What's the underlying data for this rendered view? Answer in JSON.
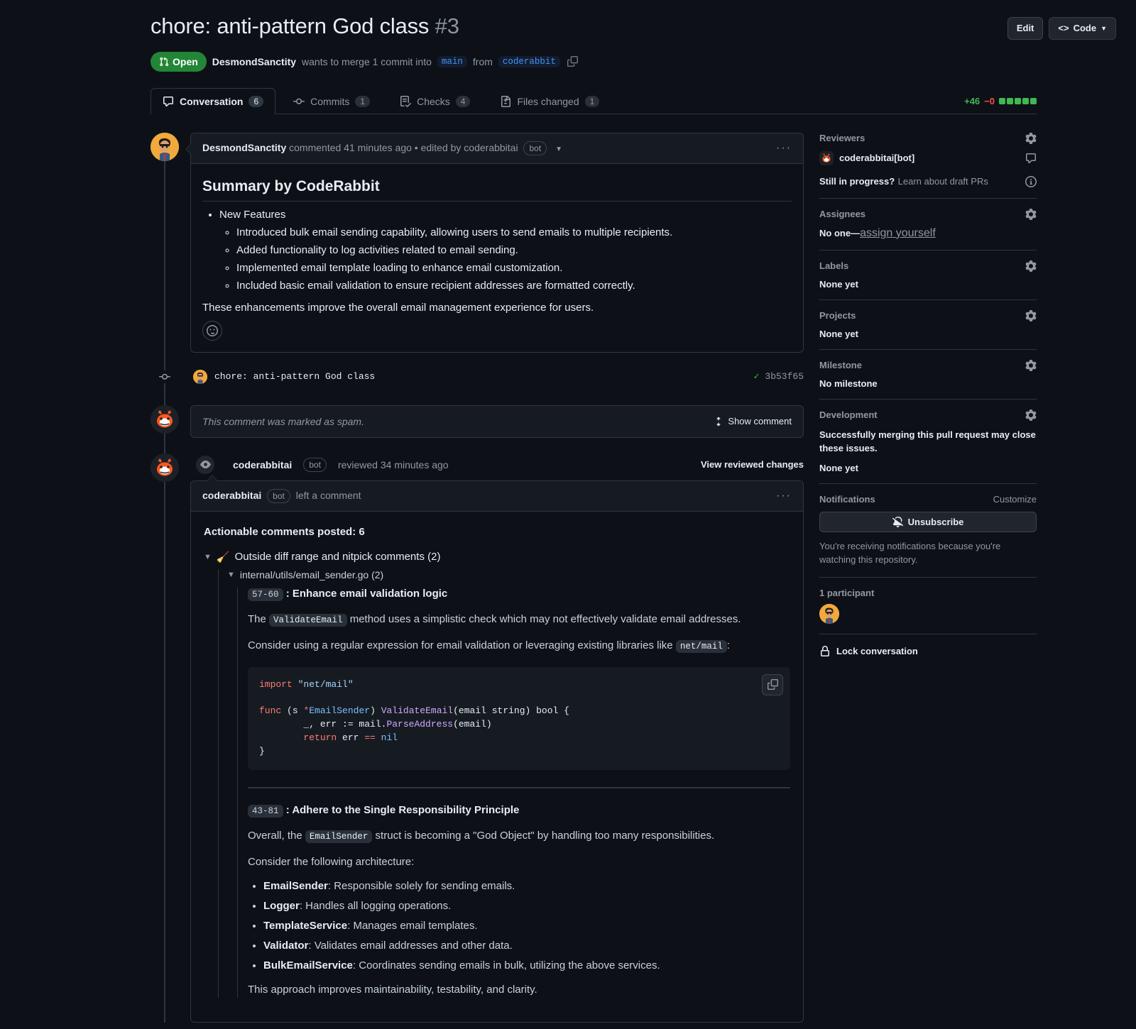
{
  "header": {
    "title": "chore: anti-pattern God class",
    "number": "#3",
    "state": "Open",
    "author": "DesmondSanctity",
    "merge_text_1": "wants to merge 1 commit into",
    "base_branch": "main",
    "from_text": "from",
    "head_branch": "coderabbit",
    "edit_label": "Edit",
    "code_label": "Code"
  },
  "tabs": [
    {
      "label": "Conversation",
      "count": "6",
      "icon": "comment-icon",
      "active": true
    },
    {
      "label": "Commits",
      "count": "1",
      "icon": "commit-icon",
      "active": false
    },
    {
      "label": "Checks",
      "count": "4",
      "icon": "checklist-icon",
      "active": false
    },
    {
      "label": "Files changed",
      "count": "1",
      "icon": "file-diff-icon",
      "active": false
    }
  ],
  "diffstat": {
    "additions": "+46",
    "deletions": "−0",
    "blocks": 5,
    "add_color": "#3fb950",
    "del_color": "#f85149"
  },
  "first_comment": {
    "author": "DesmondSanctity",
    "action": "commented 41 minutes ago",
    "separator": "•",
    "edited_by": "edited by coderabbitai",
    "bot_tag": "bot",
    "heading": "Summary by CodeRabbit",
    "section_title": "New Features",
    "features": [
      "Introduced bulk email sending capability, allowing users to send emails to multiple recipients.",
      "Added functionality to log activities related to email sending.",
      "Implemented email template loading to enhance email customization.",
      "Included basic email validation to ensure recipient addresses are formatted correctly."
    ],
    "closing": "These enhancements improve the overall email management experience for users."
  },
  "commit_row": {
    "message": "chore: anti-pattern God class",
    "sha": "3b53f65"
  },
  "spam": {
    "text": "This comment was marked as spam.",
    "show_label": "Show comment"
  },
  "review": {
    "author": "coderabbitai",
    "bot_tag": "bot",
    "action": "reviewed 34 minutes ago",
    "view_changes": "View reviewed changes",
    "comment_author": "coderabbitai",
    "comment_action": "left a comment",
    "actionable": "Actionable comments posted: 6",
    "tree_root": "Outside diff range and nitpick comments (2)",
    "tree_root_icon": "🧹",
    "tree_file": "internal/utils/email_sender.go (2)",
    "nitpicks": [
      {
        "lines": "57-60",
        "title": "Enhance email validation logic",
        "p1_pre": "The ",
        "p1_code": "ValidateEmail",
        "p1_post": " method uses a simplistic check which may not effectively validate email addresses.",
        "p2_pre": "Consider using a regular expression for email validation or leveraging existing libraries like ",
        "p2_code": "net/mail",
        "p2_post": ":"
      },
      {
        "lines": "43-81",
        "title": "Adhere to the Single Responsibility Principle",
        "p1_pre": "Overall, the ",
        "p1_code": "EmailSender",
        "p1_post": " struct is becoming a \"God Object\" by handling too many responsibilities.",
        "p2": "Consider the following architecture:",
        "closing": "This approach improves maintainability, testability, and clarity."
      }
    ],
    "architecture": [
      {
        "name": "EmailSender",
        "desc": ": Responsible solely for sending emails."
      },
      {
        "name": "Logger",
        "desc": ": Handles all logging operations."
      },
      {
        "name": "TemplateService",
        "desc": ": Manages email templates."
      },
      {
        "name": "Validator",
        "desc": ": Validates email addresses and other data."
      },
      {
        "name": "BulkEmailService",
        "desc": ": Coordinates sending emails in bulk, utilizing the above services."
      }
    ]
  },
  "code_sample": {
    "line1_kw": "import",
    "line1_str": "\"net/mail\"",
    "line3_kw": "func",
    "line3_a": " (s ",
    "line3_star": "*",
    "line3_type": "EmailSender",
    "line3_b": ") ",
    "line3_fn": "ValidateEmail",
    "line3_c": "(email string) bool {",
    "line4": "        _, err := mail.",
    "line4_fn": "ParseAddress",
    "line4_b": "(email)",
    "line5_kw": "return",
    "line5_a": " err ",
    "line5_op": "==",
    "line5_b": " nil",
    "line6": "}"
  },
  "sidebar": {
    "reviewers": {
      "title": "Reviewers",
      "name": "coderabbitai[bot]",
      "draft_bold": "Still in progress?",
      "draft_link": "Learn about draft PRs"
    },
    "assignees": {
      "title": "Assignees",
      "text": "No one—",
      "link": "assign yourself"
    },
    "labels": {
      "title": "Labels",
      "value": "None yet"
    },
    "projects": {
      "title": "Projects",
      "value": "None yet"
    },
    "milestone": {
      "title": "Milestone",
      "value": "No milestone"
    },
    "development": {
      "title": "Development",
      "text": "Successfully merging this pull request may close these issues.",
      "value": "None yet"
    },
    "notifications": {
      "title": "Notifications",
      "customize": "Customize",
      "button": "Unsubscribe",
      "reason": "You're receiving notifications because you're watching this repository."
    },
    "participants": {
      "title": "1 participant"
    },
    "lock": "Lock conversation"
  }
}
